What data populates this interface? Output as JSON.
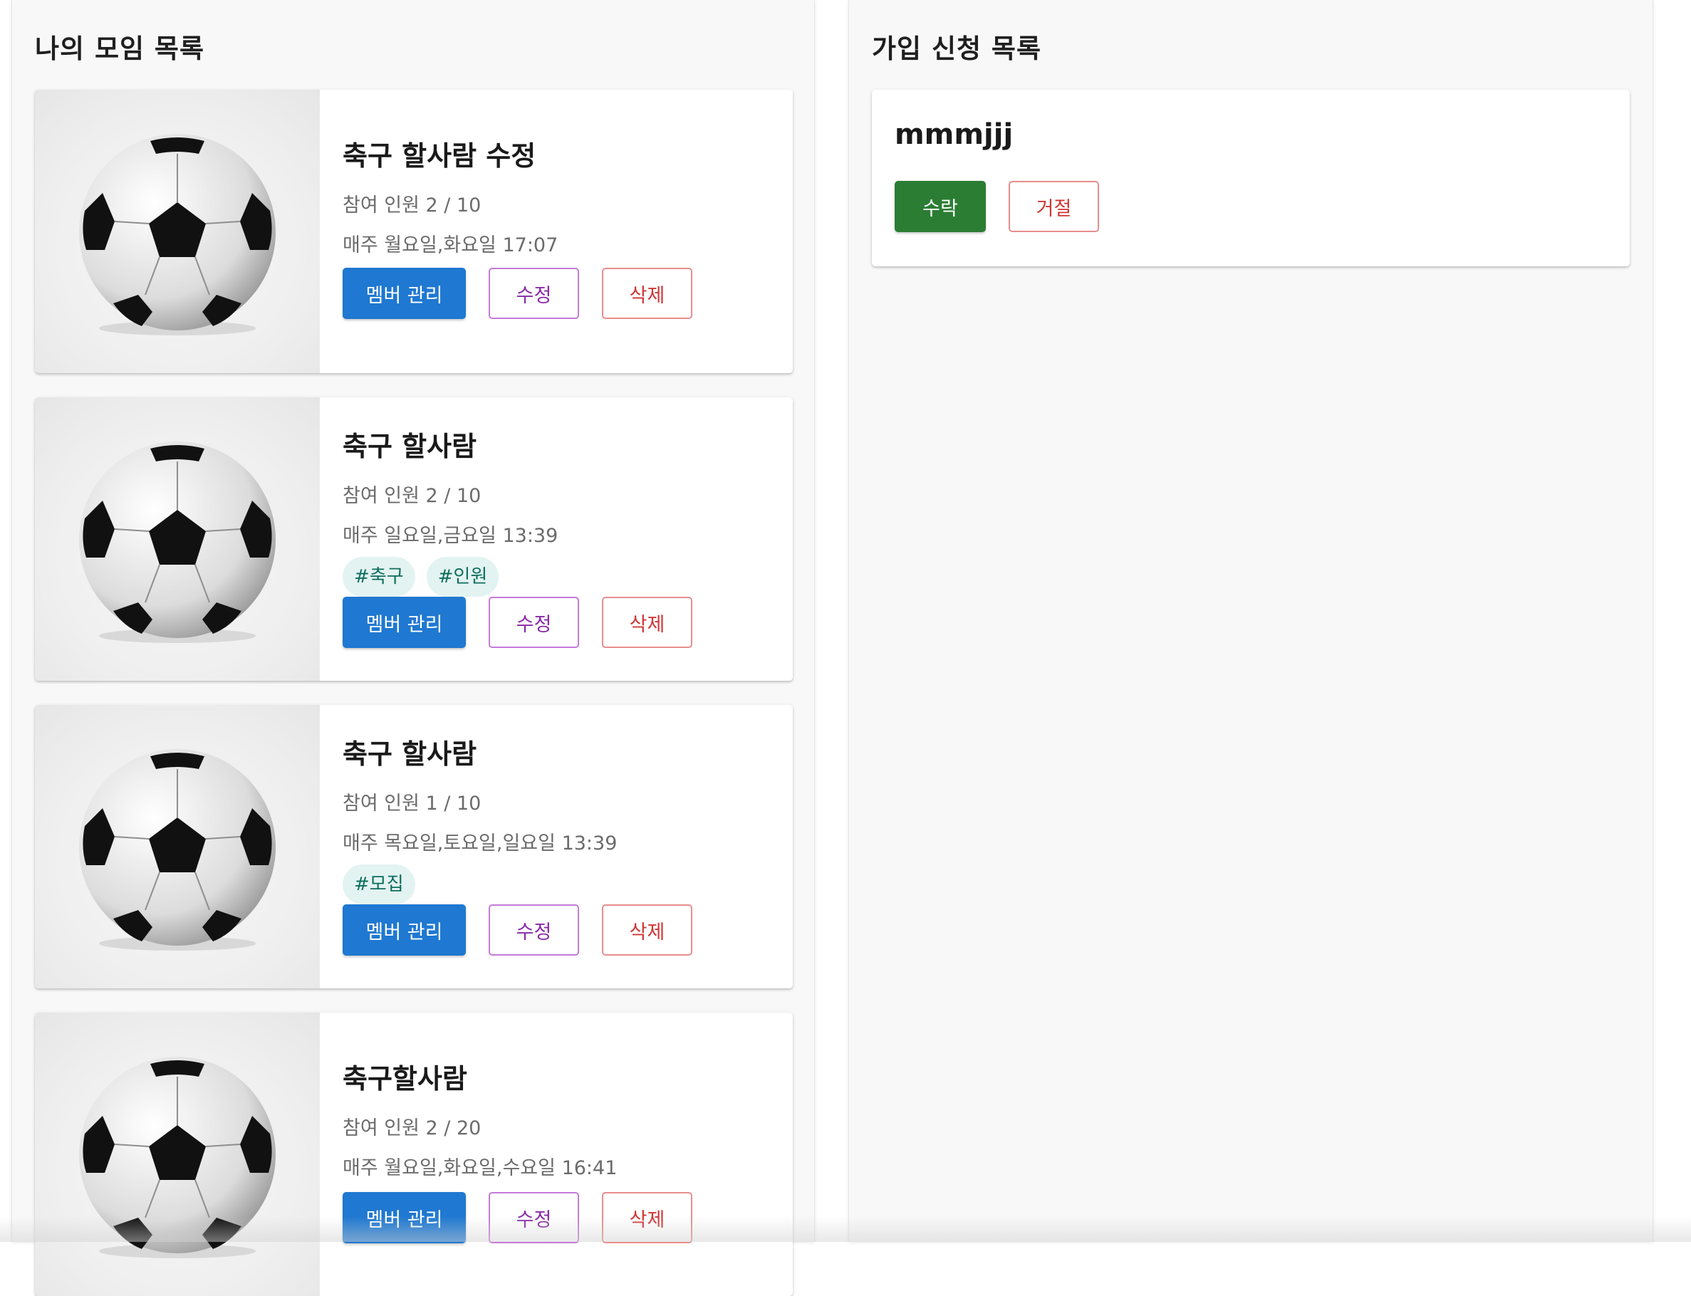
{
  "my_groups": {
    "title": "나의 모임 목록",
    "cards": [
      {
        "title": "축구 할사람 수정",
        "members": "참여 인원 2 / 10",
        "schedule": "매주 월요일,화요일 17:07",
        "tags": []
      },
      {
        "title": "축구 할사람",
        "members": "참여 인원 2 / 10",
        "schedule": "매주 일요일,금요일 13:39",
        "tags": [
          "#축구",
          "#인원"
        ]
      },
      {
        "title": "축구 할사람",
        "members": "참여 인원 1 / 10",
        "schedule": "매주 목요일,토요일,일요일 13:39",
        "tags": [
          "#모집"
        ]
      },
      {
        "title": "축구할사람",
        "members": "참여 인원 2 / 20",
        "schedule": "매주 월요일,화요일,수요일 16:41",
        "tags": []
      }
    ],
    "buttons": {
      "manage": "멤버 관리",
      "edit": "수정",
      "delete": "삭제"
    },
    "thumbnail_icon": "soccer-ball-image"
  },
  "join_requests": {
    "title": "가입 신청 목록",
    "items": [
      {
        "name": "mmmjjj"
      }
    ],
    "buttons": {
      "accept": "수락",
      "reject": "거절"
    }
  },
  "colors": {
    "primary": "#1f78d1",
    "accept": "#2b7d33",
    "edit": "#8a2aa8",
    "delete": "#d03535",
    "tag_bg": "#e3f3f1",
    "tag_text": "#0d6e5e"
  }
}
